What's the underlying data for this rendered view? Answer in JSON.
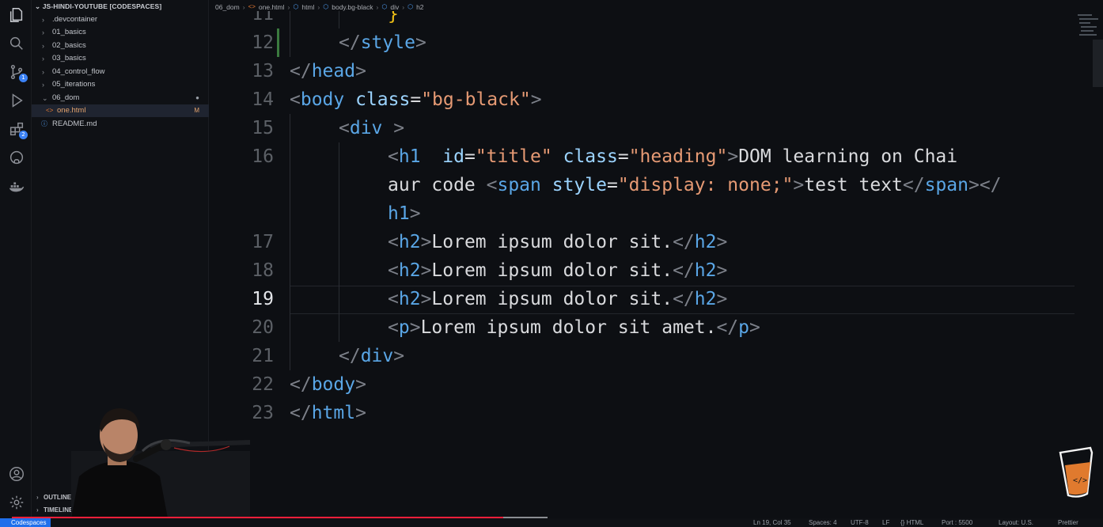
{
  "sidebar": {
    "title": "JS-HINDI-YOUTUBE [CODESPACES]",
    "items": [
      {
        "label": ".devcontainer",
        "chev": "›"
      },
      {
        "label": "01_basics",
        "chev": "›"
      },
      {
        "label": "02_basics",
        "chev": "›"
      },
      {
        "label": "03_basics",
        "chev": "›"
      },
      {
        "label": "04_control_flow",
        "chev": "›"
      },
      {
        "label": "05_iterations",
        "chev": "›"
      },
      {
        "label": "06_dom",
        "chev": "⌄",
        "mark": "●"
      },
      {
        "label": "one.html",
        "mark": "M"
      },
      {
        "label": "README.md"
      }
    ],
    "outline": "OUTLINE",
    "timeline": "TIMELINE"
  },
  "activity": {
    "source_control_badge": "1",
    "extensions_badge": "2"
  },
  "breadcrumb": [
    "06_dom",
    "one.html",
    "html",
    "body.bg-black",
    "div",
    "h2"
  ],
  "editor": {
    "line_numbers": [
      "11",
      "12",
      "13",
      "14",
      "15",
      "16",
      "17",
      "18",
      "19",
      "20",
      "21",
      "22",
      "23"
    ],
    "lines": {
      "l11": "}",
      "l12_close": "</",
      "l12_tag": "style",
      "l12_end": ">",
      "l13_open": "</",
      "l13_tag": "head",
      "l13_end": ">",
      "l14_open": "<",
      "l14_tag": "body",
      "l14_attr": " class",
      "l14_eq": "=",
      "l14_str": "\"bg-black\"",
      "l14_end": ">",
      "l15_open": "<",
      "l15_tag": "div",
      "l15_end": " >",
      "l16_open": "<",
      "l16_tag": "h1",
      "l16_attr1": "  id",
      "l16_eq1": "=",
      "l16_str1": "\"title\"",
      "l16_attr2": " class",
      "l16_eq2": "=",
      "l16_str2": "\"heading\"",
      "l16_gt": ">",
      "l16_text": "DOM learning on Chai",
      "l16b_text": "aur code ",
      "l16b_open": "<",
      "l16b_tag": "span",
      "l16b_attr": " style",
      "l16b_eq": "=",
      "l16b_str": "\"display: none;\"",
      "l16b_gt": ">",
      "l16b_text2": "test text",
      "l16b_close": "</",
      "l16b_tag2": "span",
      "l16b_gt2": "></",
      "l16c_tag": "h1",
      "l16c_gt": ">",
      "h2_text": "Lorem ipsum dolor sit.",
      "h2_tag": "h2",
      "p_tag": "p",
      "p_text": "Lorem ipsum dolor sit amet.",
      "l21_tag": "div",
      "l22_tag": "body",
      "l23_tag": "html"
    }
  },
  "status": {
    "remote": "Codespaces",
    "items": [
      "Ln 19, Col 35",
      "Spaces: 4",
      "UTF-8",
      "LF",
      "{} HTML",
      "Port : 5500",
      "Layout: U.S.",
      "Prettier"
    ]
  },
  "video_progress": 0.918,
  "colors": {
    "tag": "#5aa6e6",
    "attribute": "#9cd4ff",
    "string": "#e69a74",
    "accent": "#1f6feb",
    "progress": "#ff1f3a"
  }
}
